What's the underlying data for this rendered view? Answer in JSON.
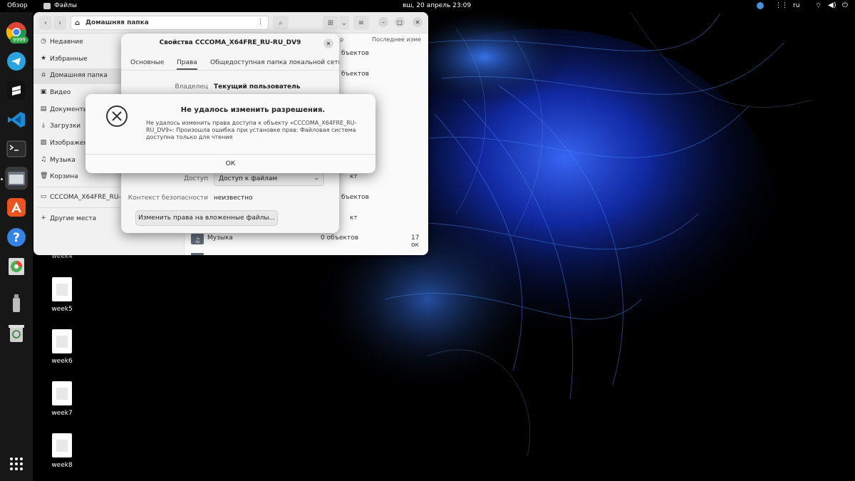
{
  "topbar": {
    "overview": "Обзор",
    "app_name": "Файлы",
    "clock": "вш, 20 апрель  23:09",
    "language": "ru"
  },
  "dock": {
    "badge": "9999",
    "apps": [
      "chrome-icon",
      "telegram-icon",
      "sublime-icon",
      "vscode-icon",
      "terminal-icon",
      "files-icon",
      "app-center-icon",
      "help-icon",
      "disk-usage-icon",
      "usb-drive-icon",
      "trash-icon",
      "show-apps-icon"
    ]
  },
  "desktop": {
    "files": [
      "week4",
      "week5",
      "week6",
      "week7",
      "week8"
    ]
  },
  "file_manager": {
    "path": "Домашняя папка",
    "columns": {
      "size": "р",
      "modified": "Последнее изме"
    },
    "sidebar": [
      {
        "label": "Недавние",
        "icon": "clock-icon"
      },
      {
        "label": "Избранные",
        "icon": "star-icon"
      },
      {
        "label": "Домашняя папка",
        "icon": "home-icon"
      },
      {
        "label": "Видео",
        "icon": "video-icon"
      },
      {
        "label": "Документы",
        "icon": "document-icon"
      },
      {
        "label": "Загрузки",
        "icon": "download-icon"
      },
      {
        "label": "Изображения",
        "icon": "image-icon"
      },
      {
        "label": "Музыка",
        "icon": "music-icon"
      },
      {
        "label": "Корзина",
        "icon": "trash-icon"
      },
      {
        "label": "CCCOMA_X64FRE_RU-RU",
        "icon": "drive-icon"
      },
      {
        "label": "Другие места",
        "icon": "plus-icon"
      }
    ],
    "rows": [
      {
        "name": "",
        "size": "бъектов",
        "modified": ""
      },
      {
        "name": "",
        "size": "бъектов",
        "modified": ""
      },
      {
        "name": "",
        "size": "кт",
        "modified": ""
      },
      {
        "name": "",
        "size": "бъектов",
        "modified": ""
      },
      {
        "name": "",
        "size": "кт",
        "modified": ""
      },
      {
        "name": "Музыка",
        "size": "0 объектов",
        "modified": "17 ок"
      }
    ]
  },
  "properties": {
    "title": "Свойства CCCOMA_X64FRE_RU-RU_DV9",
    "tabs": [
      "Основные",
      "Права",
      "Общедоступная папка локальной сети"
    ],
    "owner_label": "Владелец",
    "owner_value": "Текущий пользователь",
    "access_label": "Доступ",
    "access_value": "Доступ к файлам",
    "security_label": "Контекст безопасности",
    "security_value": "неизвестно",
    "apply_button": "Изменить права на вложенные файлы..."
  },
  "error": {
    "title": "Не удалось изменить разрешения.",
    "message": "Не удалось изменить права доступа к объекту «CCCOMA_X64FRE_RU-RU_DV9»: Произошла ошибка при установке прав: Файловая система доступна только для чтения",
    "ok": "ОК"
  }
}
